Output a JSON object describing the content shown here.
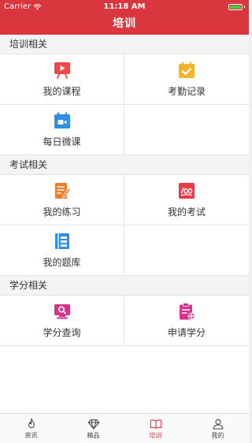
{
  "status_bar": {
    "carrier": "Carrier",
    "time": "11:18 AM",
    "battery_level": 1.0
  },
  "nav": {
    "title": "培训"
  },
  "sections": [
    {
      "title": "培训相关",
      "items": [
        {
          "label": "我的课程",
          "icon": "course-icon",
          "color": "#f04848"
        },
        {
          "label": "考勤记录",
          "icon": "attendance-icon",
          "color": "#f2b42b"
        },
        {
          "label": "每日微课",
          "icon": "daily-microclass-icon",
          "color": "#2f8fe6"
        }
      ]
    },
    {
      "title": "考试相关",
      "items": [
        {
          "label": "我的练习",
          "icon": "practice-icon",
          "color": "#f07d2b"
        },
        {
          "label": "我的考试",
          "icon": "exam-icon",
          "color": "#e83a48"
        },
        {
          "label": "我的题库",
          "icon": "question-bank-icon",
          "color": "#2f8fe6"
        }
      ]
    },
    {
      "title": "学分相关",
      "items": [
        {
          "label": "学分查询",
          "icon": "credit-query-icon",
          "color": "#d63287"
        },
        {
          "label": "申请学分",
          "icon": "apply-credit-icon",
          "color": "#d63287"
        }
      ]
    }
  ],
  "tabbar": {
    "active": 2,
    "tabs": [
      {
        "label": "资讯",
        "icon": "fire-icon"
      },
      {
        "label": "精品",
        "icon": "diamond-icon"
      },
      {
        "label": "培训",
        "icon": "book-icon"
      },
      {
        "label": "我的",
        "icon": "person-icon"
      }
    ]
  },
  "colors": {
    "primary": "#d9363e",
    "battery": "#3fd13f"
  }
}
